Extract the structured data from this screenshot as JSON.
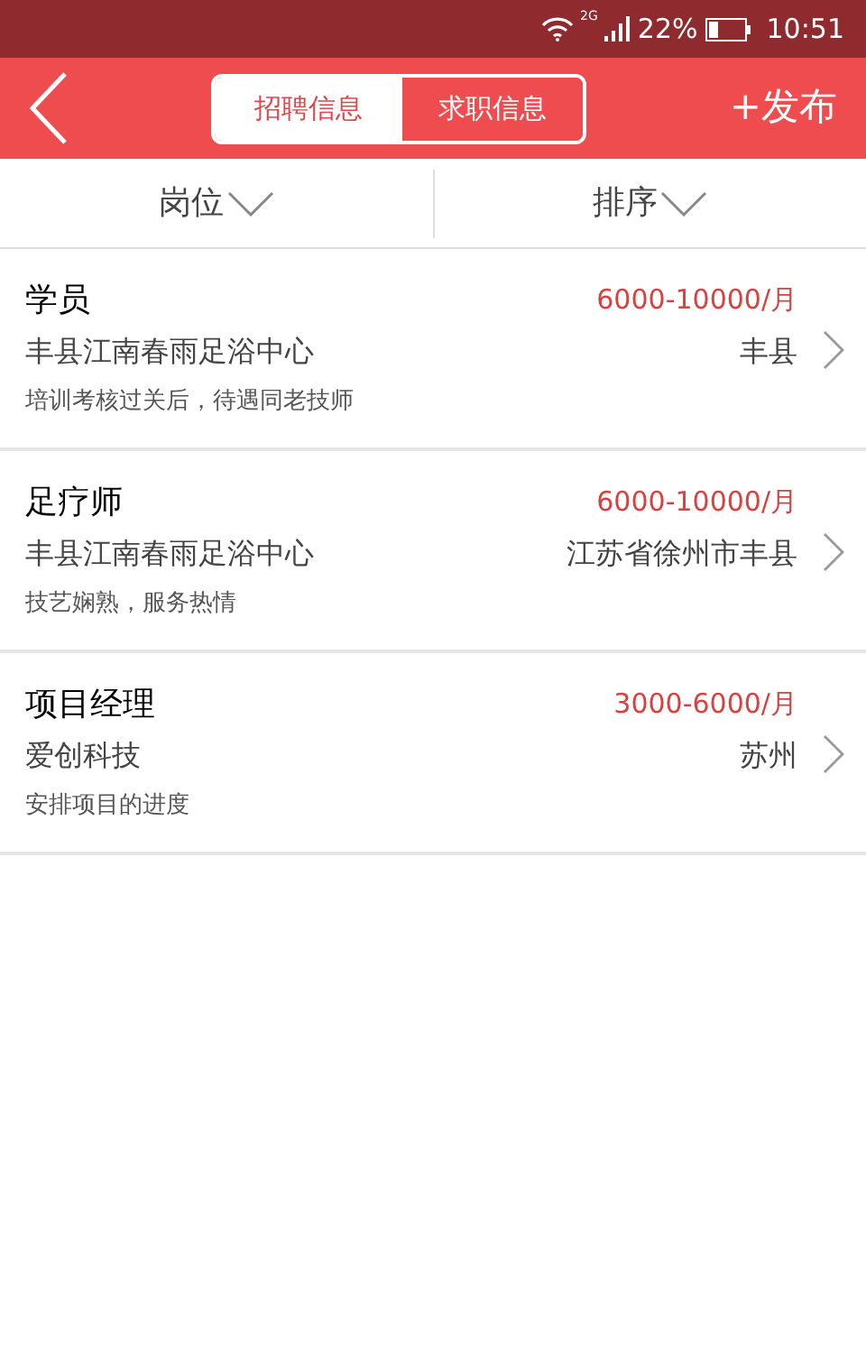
{
  "status_bar": {
    "network": "2G",
    "battery": "22%",
    "time": "10:51"
  },
  "header": {
    "tabs": [
      {
        "label": "招聘信息",
        "selected": true
      },
      {
        "label": "求职信息",
        "selected": false
      }
    ],
    "action": "+发布"
  },
  "filters": [
    "岗位",
    "排序"
  ],
  "jobs": [
    {
      "title": "学员",
      "salary": "6000-10000/月",
      "company": "丰县江南春雨足浴中心",
      "location": "丰县",
      "description": "培训考核过关后，待遇同老技师"
    },
    {
      "title": "足疗师",
      "salary": "6000-10000/月",
      "company": "丰县江南春雨足浴中心",
      "location": "江苏省徐州市丰县",
      "description": "技艺娴熟，服务热情"
    },
    {
      "title": "项目经理",
      "salary": "3000-6000/月",
      "company": "爱创科技",
      "location": "苏州",
      "description": "安排项目的进度"
    }
  ]
}
